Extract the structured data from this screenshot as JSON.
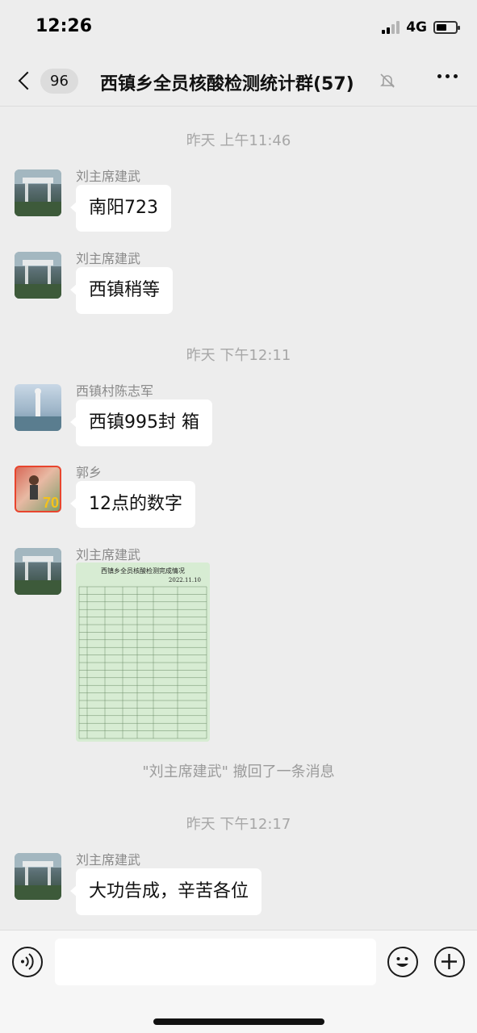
{
  "status_bar": {
    "time": "12:26",
    "network": "4G",
    "battery_level": 0.55
  },
  "nav": {
    "unread_count": "96",
    "title": "西镇乡全员核酸检测统计群(57)"
  },
  "messages": [
    {
      "type": "timestamp",
      "text": "昨天 上午11:46"
    },
    {
      "type": "text",
      "sender": "刘主席建武",
      "text": "南阳723",
      "avatar": "gate-photo"
    },
    {
      "type": "text",
      "sender": "刘主席建武",
      "text": "西镇稍等",
      "avatar": "gate-photo"
    },
    {
      "type": "timestamp",
      "text": "昨天 下午12:11"
    },
    {
      "type": "text",
      "sender": "西镇村陈志军",
      "text": "西镇995封 箱",
      "avatar": "statue-photo"
    },
    {
      "type": "text",
      "sender": "郭乡",
      "text": "12点的数字",
      "avatar": "person-photo",
      "avatar_badge": "70"
    },
    {
      "type": "image",
      "sender": "刘主席建武",
      "avatar": "gate-photo",
      "image_title": "西镇乡全员核酸检测完成情况",
      "image_date": "2022.11.10"
    },
    {
      "type": "recall",
      "text": "\"刘主席建武\" 撤回了一条消息"
    },
    {
      "type": "timestamp",
      "text": "昨天 下午12:17"
    },
    {
      "type": "text",
      "sender": "刘主席建武",
      "text": "大功告成，辛苦各位",
      "avatar": "gate-photo"
    }
  ],
  "colors": {
    "background": "#ededed",
    "bubble": "#ffffff",
    "table_bg": "#d7ecd3",
    "muted_text": "#a7a7a7"
  },
  "icons": [
    "back-chevron-icon",
    "mute-bell-icon",
    "more-dots-icon",
    "voice-icon",
    "emoji-icon",
    "plus-icon"
  ]
}
